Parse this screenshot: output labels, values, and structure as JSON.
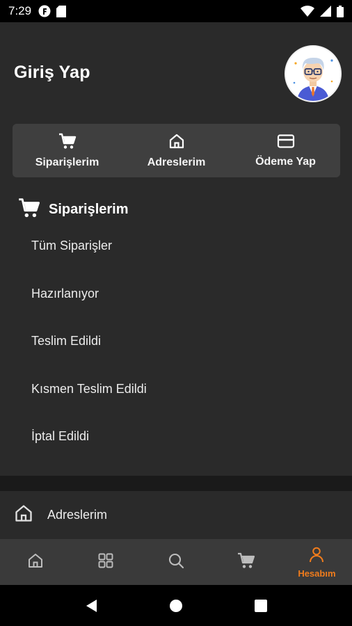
{
  "status": {
    "time": "7:29",
    "left_icons": [
      "f-logo-icon",
      "sd-card-icon"
    ],
    "right_icons": [
      "wifi-icon",
      "signal-icon",
      "battery-icon"
    ]
  },
  "header": {
    "title": "Giriş Yap",
    "avatar_icon": "user-avatar-icon"
  },
  "quick_actions": [
    {
      "label": "Siparişlerim",
      "icon": "cart-icon"
    },
    {
      "label": "Adreslerim",
      "icon": "home-icon"
    },
    {
      "label": "Ödeme Yap",
      "icon": "credit-card-icon"
    }
  ],
  "orders_section": {
    "title": "Siparişlerim",
    "icon": "cart-icon",
    "items": [
      "Tüm Siparişler",
      "Hazırlanıyor",
      "Teslim Edildi",
      "Kısmen Teslim Edildi",
      "İptal Edildi"
    ]
  },
  "addresses_row": {
    "label": "Adreslerim",
    "icon": "home-icon"
  },
  "tabbar": {
    "tabs": [
      {
        "icon": "home-icon",
        "label": ""
      },
      {
        "icon": "grid-icon",
        "label": ""
      },
      {
        "icon": "search-icon",
        "label": ""
      },
      {
        "icon": "cart-icon",
        "label": ""
      },
      {
        "icon": "user-icon",
        "label": "Hesabım",
        "active": true
      }
    ],
    "active_color": "#f07c1c"
  },
  "system_nav": [
    "back-icon",
    "home-circle-icon",
    "recents-icon"
  ]
}
